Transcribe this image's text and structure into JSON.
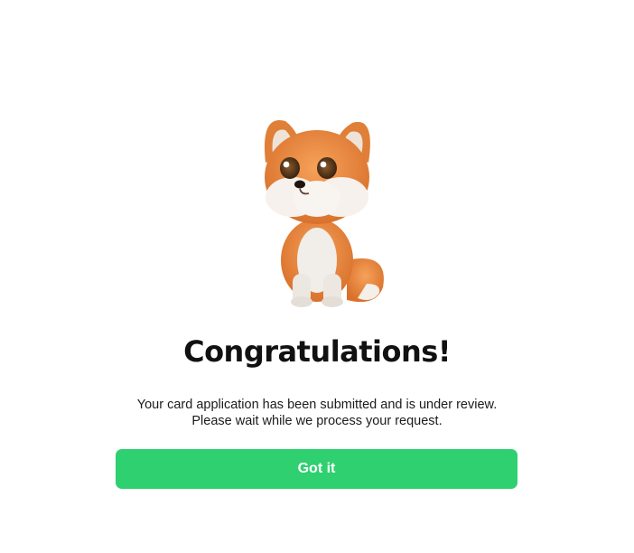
{
  "dialog": {
    "title": "Congratulations!",
    "message_line_1": "Your card application has been submitted and is under review.",
    "message_line_2": "Please wait while we process your request.",
    "button_label": "Got it",
    "mascot_icon": "fox-mascot-icon"
  },
  "colors": {
    "accent": "#2ed070",
    "title_text": "#111111",
    "body_text": "#1b1b1b",
    "background": "#ffffff"
  }
}
